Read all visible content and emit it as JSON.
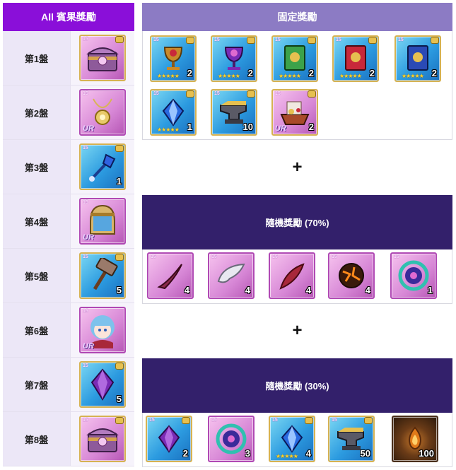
{
  "headers": {
    "all_bingo": "All 賓果獎勵",
    "fixed": "固定獎勵"
  },
  "plus_sign": "+",
  "random_headers": [
    "隨機獎勵 (70%)",
    "隨機獎勵 (30%)"
  ],
  "plates": [
    {
      "label": "第1盤",
      "item": {
        "name": "pink-treasure-chest",
        "count": ""
      }
    },
    {
      "label": "第2盤",
      "item": {
        "name": "gold-pendant-ur",
        "count": "",
        "ur": "UR"
      }
    },
    {
      "label": "第3盤",
      "item": {
        "name": "blue-gem-scepter",
        "count": "1"
      }
    },
    {
      "label": "第4盤",
      "item": {
        "name": "golden-helmet-ur",
        "count": "",
        "ur": "UR"
      }
    },
    {
      "label": "第5盤",
      "item": {
        "name": "bronze-hammer",
        "count": "5"
      }
    },
    {
      "label": "第6盤",
      "item": {
        "name": "rem-character-ur",
        "count": "",
        "ur": "UR"
      }
    },
    {
      "label": "第7盤",
      "item": {
        "name": "purple-egg-gem",
        "count": "5"
      }
    },
    {
      "label": "第8盤",
      "item": {
        "name": "pink-treasure-chest",
        "count": ""
      }
    }
  ],
  "fixed_rewards": [
    {
      "name": "gold-chalice-red",
      "count": "2",
      "stars": "★★★★★"
    },
    {
      "name": "purple-chalice",
      "count": "2",
      "stars": "★★★★★"
    },
    {
      "name": "green-tome",
      "count": "2",
      "stars": "★★★★★"
    },
    {
      "name": "red-tome",
      "count": "2",
      "stars": "★★★★★"
    },
    {
      "name": "blue-tome",
      "count": "2",
      "stars": "★★★★★"
    },
    {
      "name": "blue-crystal",
      "count": "1",
      "stars": "★★★★★"
    },
    {
      "name": "anvil",
      "count": "10",
      "stars": ""
    },
    {
      "name": "treasure-ship-ur",
      "count": "2",
      "stars": "",
      "ur": "UR"
    }
  ],
  "random_rewards_70": [
    {
      "name": "horn",
      "count": "4"
    },
    {
      "name": "white-wing",
      "count": "4"
    },
    {
      "name": "red-feather",
      "count": "4"
    },
    {
      "name": "lava-rock",
      "count": "4"
    },
    {
      "name": "rainbow-orb",
      "count": "1"
    }
  ],
  "random_rewards_30": [
    {
      "name": "purple-egg-gem",
      "count": "2",
      "stars": ""
    },
    {
      "name": "rainbow-orb",
      "count": "3",
      "stars": ""
    },
    {
      "name": "blue-crystal",
      "count": "4",
      "stars": "★★★★★"
    },
    {
      "name": "anvil",
      "count": "50",
      "stars": ""
    },
    {
      "name": "fire-gem",
      "count": "100",
      "stars": ""
    }
  ],
  "colors": {
    "left_header": "#8a0fd9",
    "fixed_header": "#8c7bc4",
    "random_header": "#33206b",
    "label_bg": "#ece7f7"
  }
}
